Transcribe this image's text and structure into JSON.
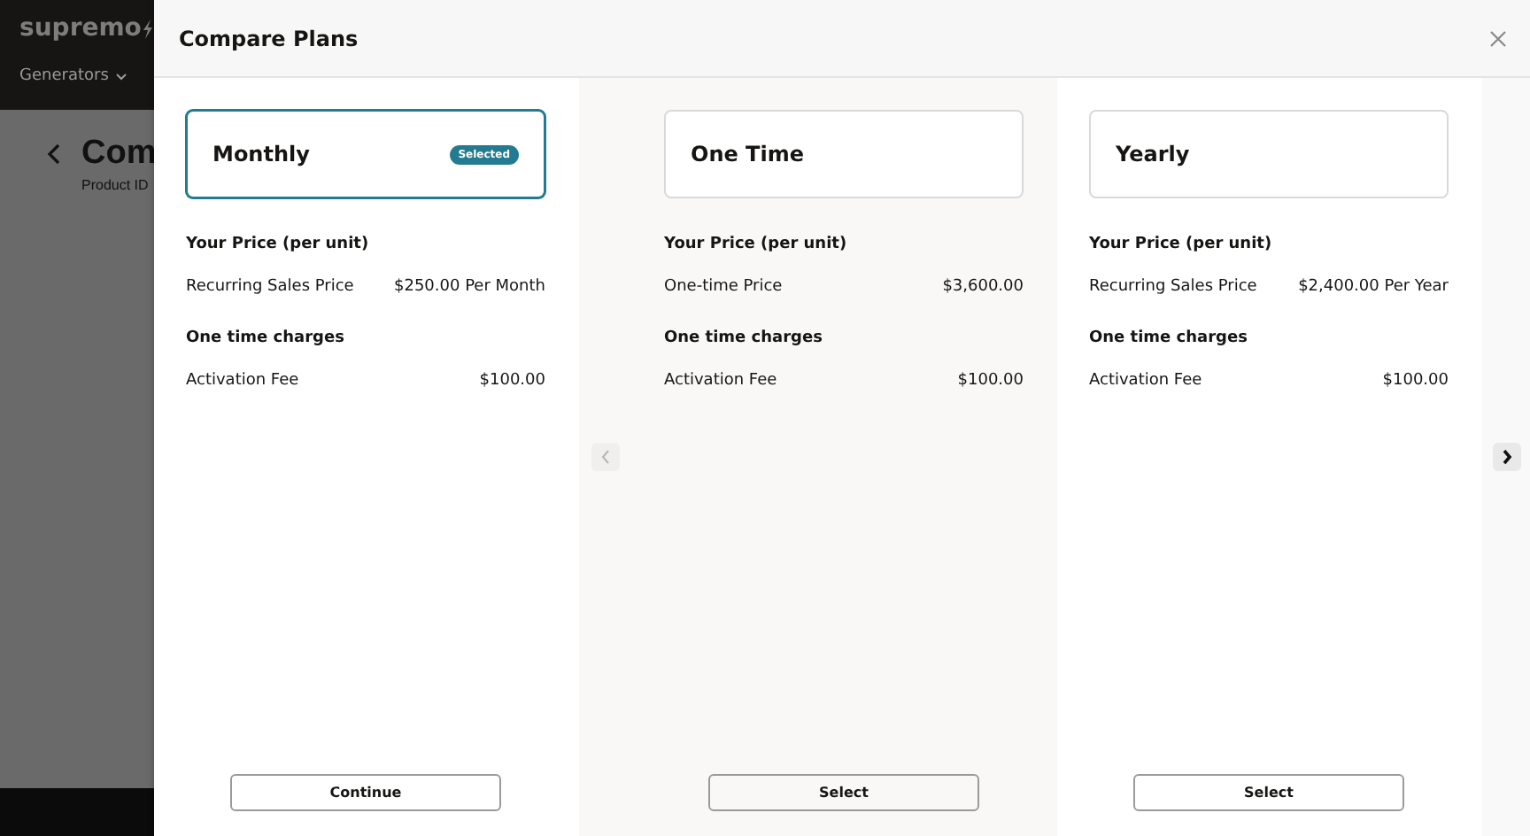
{
  "background": {
    "logo": "supremo",
    "nav": "Generators",
    "title": "Com",
    "subtitle": "Product ID"
  },
  "dialog": {
    "title": "Compare Plans",
    "plans": [
      {
        "name": "Monthly",
        "selected": true,
        "badge": "Selected",
        "price_heading": "Your Price (per unit)",
        "price_label": "Recurring Sales Price",
        "price_value": "$250.00 Per Month",
        "charges_heading": "One time charges",
        "fee_label": "Activation Fee",
        "fee_value": "$100.00",
        "button": "Continue"
      },
      {
        "name": "One Time",
        "selected": false,
        "price_heading": "Your Price (per unit)",
        "price_label": "One-time Price",
        "price_value": "$3,600.00",
        "charges_heading": "One time charges",
        "fee_label": "Activation Fee",
        "fee_value": "$100.00",
        "button": "Select"
      },
      {
        "name": "Yearly",
        "selected": false,
        "price_heading": "Your Price (per unit)",
        "price_label": "Recurring Sales Price",
        "price_value": "$2,400.00 Per Year",
        "charges_heading": "One time charges",
        "fee_label": "Activation Fee",
        "fee_value": "$100.00",
        "button": "Select"
      }
    ],
    "prev_disabled": true,
    "next_disabled": false
  }
}
